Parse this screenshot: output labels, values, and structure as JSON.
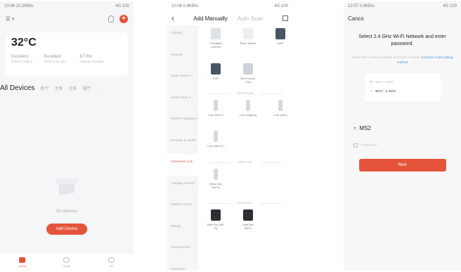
{
  "screen1": {
    "status_time": "10:06 10.2KB/s",
    "status_right": "4G 100",
    "home_label": "家 ▾",
    "temperature": "32°C",
    "weather": [
      {
        "value": "Excellent",
        "label": "Outdoor PM2.5"
      },
      {
        "value": "Excellent",
        "label": "Outdoor air qua..."
      },
      {
        "value": "67.0%",
        "label": "Outdoor humidity"
      }
    ],
    "tab_main": "All Devices",
    "tabs": [
      "卧厅",
      "主卧",
      "次卧",
      "餐厅"
    ],
    "more": "···",
    "empty_text": "No devices",
    "add_device": "Add Device",
    "nav": [
      "Home",
      "Smart",
      "Me"
    ]
  },
  "screen2": {
    "status_time": "10:06 0.8KB/s",
    "status_right": "4G 100",
    "back": "‹",
    "tab_manual": "Add Manually",
    "tab_auto": "Auto Scan",
    "categories": [
      {
        "label": "Lighting",
        "active": false
      },
      {
        "label": "Sensors",
        "active": false
      },
      {
        "label": "Large Home A...",
        "active": false
      },
      {
        "label": "Small Home A...",
        "active": false
      },
      {
        "label": "Kitchen Appliances",
        "active": false
      },
      {
        "label": "Exercise & Health",
        "active": false
      },
      {
        "label": "Camera & Lock",
        "active": true
      },
      {
        "label": "Gateway Control",
        "active": false
      },
      {
        "label": "Outdoor Travel",
        "active": false
      },
      {
        "label": "Energy",
        "active": false
      },
      {
        "label": "Entertainment",
        "active": false
      },
      {
        "label": "Industry & Agriculture",
        "active": false
      }
    ],
    "top_devices": [
      "Floodlight Camera",
      "Base Station",
      "NVR"
    ],
    "mid_devices": [
      "DVR",
      "Bird Feeder Cam"
    ],
    "section_smart_lock": "Smart Lock",
    "locks": [
      "Lock (Wi-Fi)",
      "Lock (Zigbee)",
      "Lock (BLE)",
      "Lock (NB-IoT)"
    ],
    "section_video_lock": "Video lock",
    "video_locks": [
      "Video lock (Wi-Fi)"
    ],
    "section_smart_box": "Smart box",
    "boxes": [
      "Safe Box (Wi-Fi)",
      "Safe Box (BLE)"
    ]
  },
  "screen3": {
    "status_time": "12:07 0.4KB/s",
    "status_right": "4G 100",
    "cancel": "Cancs",
    "title": "Select 2.4 GHz Wi-Fi Network and enter password.",
    "subtitle": "If your Wi-Fi is 5GHz, please set it to be 2.4GHz.",
    "subtitle_link": "Common router setting method",
    "wifi_5g": "Wi-Fi - 5Ghz",
    "wifi_24g": "Wi-Fi - 2.4Ghz",
    "ssid": "MS2",
    "password_placeholder": "Password",
    "next": "Next"
  },
  "colors": {
    "accent": "#e5543a",
    "link": "#4a90e2"
  }
}
